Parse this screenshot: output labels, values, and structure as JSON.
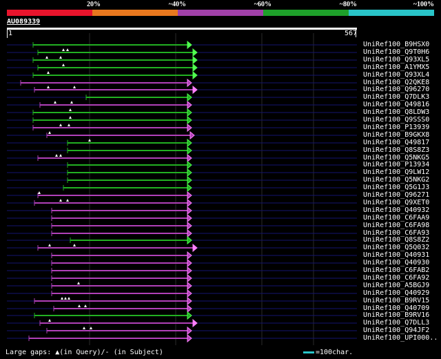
{
  "query": {
    "id": "AU089339",
    "start": "1",
    "end": "567",
    "length": 567
  },
  "legend": {
    "labels": [
      "20%",
      "~40%",
      "~60%",
      "~80%",
      "~100%"
    ],
    "colors": [
      "#e8142c",
      "#e8781e",
      "#a040a8",
      "#1ea02a",
      "#29c4c8"
    ]
  },
  "footer": {
    "large_gaps": "Large gaps:",
    "query_gap": "(in Query)/",
    "subject_gap": "(in Subject)",
    "scale_text": "=100char."
  },
  "hits": [
    {
      "label": "UniRef100_B9HSX0",
      "color": "green",
      "start": 48,
      "end": 278,
      "gaps": [],
      "arrow": "open"
    },
    {
      "label": "UniRef100_Q9T0H6",
      "color": "green",
      "start": 55,
      "end": 286,
      "gaps": [
        92,
        98
      ],
      "arrow": "open"
    },
    {
      "label": "UniRef100_Q93XL5",
      "color": "green",
      "start": 48,
      "end": 286,
      "gaps": [
        68,
        88
      ],
      "arrow": "open"
    },
    {
      "label": "UniRef100_A1YMX5",
      "color": "green",
      "start": 55,
      "end": 286,
      "gaps": [
        92
      ],
      "arrow": "open"
    },
    {
      "label": "UniRef100_Q93XL4",
      "color": "green",
      "start": 48,
      "end": 286,
      "gaps": [
        70
      ],
      "arrow": "open"
    },
    {
      "label": "UniRef100_Q2QKE8",
      "color": "purple",
      "start": 30,
      "end": 278,
      "gaps": [],
      "arrow": "solid"
    },
    {
      "label": "UniRef100_Q96270",
      "color": "purple",
      "start": 50,
      "end": 286,
      "gaps": [
        70,
        108
      ],
      "arrow": "open"
    },
    {
      "label": "UniRef100_Q7DLK3",
      "color": "green",
      "start": 125,
      "end": 278,
      "gaps": [],
      "arrow": "solid"
    },
    {
      "label": "UniRef100_Q49816",
      "color": "purple",
      "start": 58,
      "end": 278,
      "gaps": [
        80,
        104
      ],
      "arrow": "solid"
    },
    {
      "label": "UniRef100_Q8LDW3",
      "color": "green",
      "start": 48,
      "end": 278,
      "gaps": [
        102
      ],
      "arrow": "solid"
    },
    {
      "label": "UniRef100_Q9SSS0",
      "color": "green",
      "start": 48,
      "end": 278,
      "gaps": [
        102
      ],
      "arrow": "solid"
    },
    {
      "label": "UniRef100_P13939",
      "color": "purple",
      "start": 48,
      "end": 278,
      "gaps": [
        88,
        100
      ],
      "arrow": "solid"
    },
    {
      "label": "UniRef100_B9GKX8",
      "color": "purple",
      "start": 68,
      "end": 282,
      "gaps": [
        72
      ],
      "arrow": "solid"
    },
    {
      "label": "UniRef100_Q49817",
      "color": "green",
      "start": 98,
      "end": 278,
      "gaps": [
        130
      ],
      "arrow": "solid"
    },
    {
      "label": "UniRef100_Q8S8Z3",
      "color": "green",
      "start": 98,
      "end": 278,
      "gaps": [],
      "arrow": "solid"
    },
    {
      "label": "UniRef100_Q5NKG5",
      "color": "purple",
      "start": 55,
      "end": 278,
      "gaps": [
        82,
        88
      ],
      "arrow": "solid"
    },
    {
      "label": "UniRef100_P13934",
      "color": "green",
      "start": 98,
      "end": 278,
      "gaps": [],
      "arrow": "solid"
    },
    {
      "label": "UniRef100_Q9LW12",
      "color": "green",
      "start": 98,
      "end": 278,
      "gaps": [],
      "arrow": "solid"
    },
    {
      "label": "UniRef100_Q5NKG2",
      "color": "green",
      "start": 98,
      "end": 278,
      "gaps": [],
      "arrow": "solid"
    },
    {
      "label": "UniRef100_Q5G1J3",
      "color": "green",
      "start": 92,
      "end": 278,
      "gaps": [],
      "arrow": "solid"
    },
    {
      "label": "UniRef100_Q96271",
      "color": "purple",
      "start": 55,
      "end": 278,
      "gaps": [
        57
      ],
      "arrow": "solid"
    },
    {
      "label": "UniRef100_Q9XET0",
      "color": "purple",
      "start": 50,
      "end": 278,
      "gaps": [
        88,
        98
      ],
      "arrow": "solid"
    },
    {
      "label": "UniRef100_Q40932",
      "color": "purple",
      "start": 75,
      "end": 278,
      "gaps": [],
      "arrow": "solid"
    },
    {
      "label": "UniRef100_C6FAA9",
      "color": "purple",
      "start": 75,
      "end": 278,
      "gaps": [],
      "arrow": "solid"
    },
    {
      "label": "UniRef100_C6FA98",
      "color": "purple",
      "start": 75,
      "end": 278,
      "gaps": [],
      "arrow": "solid"
    },
    {
      "label": "UniRef100_C6FA93",
      "color": "purple",
      "start": 75,
      "end": 278,
      "gaps": [],
      "arrow": "solid"
    },
    {
      "label": "UniRef100_Q8S8Z2",
      "color": "green",
      "start": 102,
      "end": 278,
      "gaps": [],
      "arrow": "solid"
    },
    {
      "label": "UniRef100_Q5Q032",
      "color": "purple",
      "start": 55,
      "end": 286,
      "gaps": [
        72,
        108
      ],
      "arrow": "open"
    },
    {
      "label": "UniRef100_Q40931",
      "color": "purple",
      "start": 75,
      "end": 278,
      "gaps": [],
      "arrow": "solid"
    },
    {
      "label": "UniRef100_Q40930",
      "color": "purple",
      "start": 75,
      "end": 278,
      "gaps": [],
      "arrow": "solid"
    },
    {
      "label": "UniRef100_C6FAB2",
      "color": "purple",
      "start": 75,
      "end": 278,
      "gaps": [],
      "arrow": "solid"
    },
    {
      "label": "UniRef100_C6FA92",
      "color": "purple",
      "start": 75,
      "end": 278,
      "gaps": [],
      "arrow": "solid"
    },
    {
      "label": "UniRef100_A5BGJ9",
      "color": "purple",
      "start": 75,
      "end": 278,
      "gaps": [
        114
      ],
      "arrow": "solid"
    },
    {
      "label": "UniRef100_Q40929",
      "color": "purple",
      "start": 75,
      "end": 278,
      "gaps": [],
      "arrow": "solid"
    },
    {
      "label": "UniRef100_B9RV15",
      "color": "purple",
      "start": 50,
      "end": 278,
      "gaps": [
        90,
        95,
        100
      ],
      "arrow": "solid"
    },
    {
      "label": "UniRef100_Q40709",
      "color": "purple",
      "start": 78,
      "end": 278,
      "gaps": [
        115,
        124
      ],
      "arrow": "solid"
    },
    {
      "label": "UniRef100_B9RV16",
      "color": "green",
      "start": 50,
      "end": 278,
      "gaps": [],
      "arrow": "solid"
    },
    {
      "label": "UniRef100_Q7DLL3",
      "color": "purple",
      "start": 58,
      "end": 286,
      "gaps": [
        72
      ],
      "arrow": "open"
    },
    {
      "label": "UniRef100_Q94JF2",
      "color": "purple",
      "start": 68,
      "end": 278,
      "gaps": [
        122,
        132
      ],
      "arrow": "solid"
    },
    {
      "label": "UniRef100_UPI000..",
      "color": "purple",
      "start": 42,
      "end": 278,
      "gaps": [],
      "arrow": "solid"
    }
  ]
}
